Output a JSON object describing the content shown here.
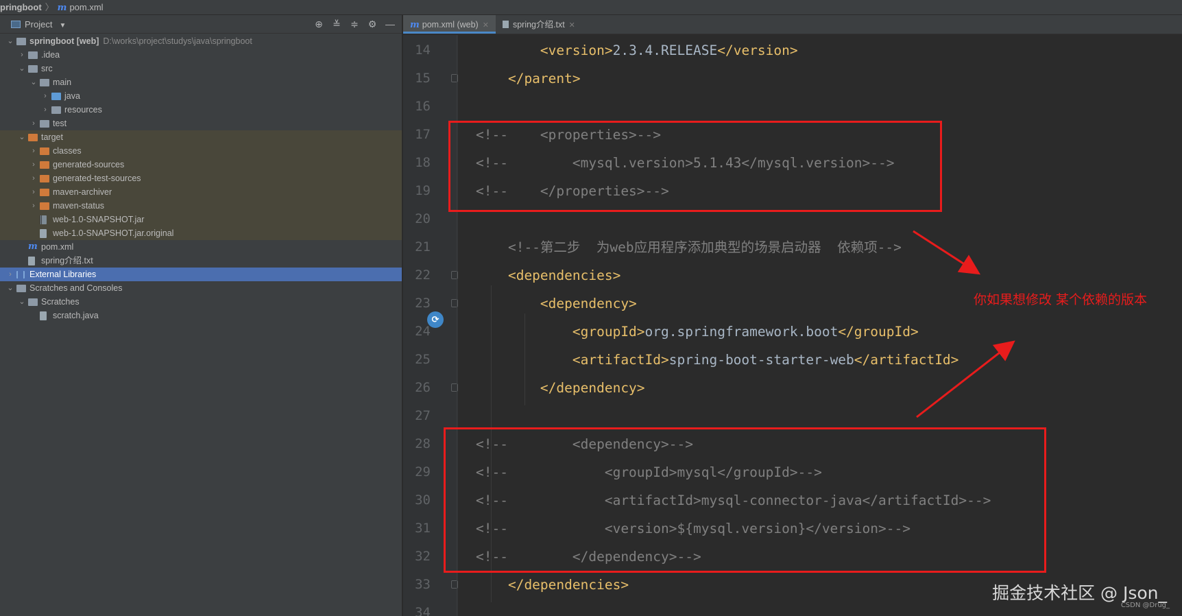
{
  "breadcrumb": {
    "project": "pringboot",
    "file": "pom.xml"
  },
  "project_panel": {
    "title": "Project",
    "tool_icons": [
      "locate-icon",
      "expand-all-icon",
      "collapse-all-icon",
      "gear-icon",
      "minimize-icon"
    ]
  },
  "tree": [
    {
      "indent": 0,
      "arrow": "v",
      "icon": "module-folder",
      "label": "springboot",
      "suffix": "[web]",
      "path": "D:\\works\\project\\studys\\java\\springboot"
    },
    {
      "indent": 1,
      "arrow": ">",
      "icon": "folder",
      "label": ".idea"
    },
    {
      "indent": 1,
      "arrow": "v",
      "icon": "folder",
      "label": "src"
    },
    {
      "indent": 2,
      "arrow": "v",
      "icon": "folder",
      "label": "main"
    },
    {
      "indent": 3,
      "arrow": ">",
      "icon": "source-folder",
      "label": "java"
    },
    {
      "indent": 3,
      "arrow": ">",
      "icon": "resources-folder",
      "label": "resources"
    },
    {
      "indent": 2,
      "arrow": ">",
      "icon": "folder",
      "label": "test"
    },
    {
      "indent": 1,
      "arrow": "v",
      "icon": "excluded-folder",
      "label": "target",
      "excluded": true
    },
    {
      "indent": 2,
      "arrow": ">",
      "icon": "excluded-folder",
      "label": "classes",
      "excluded": true
    },
    {
      "indent": 2,
      "arrow": ">",
      "icon": "excluded-folder",
      "label": "generated-sources",
      "excluded": true
    },
    {
      "indent": 2,
      "arrow": ">",
      "icon": "excluded-folder",
      "label": "generated-test-sources",
      "excluded": true
    },
    {
      "indent": 2,
      "arrow": ">",
      "icon": "excluded-folder",
      "label": "maven-archiver",
      "excluded": true
    },
    {
      "indent": 2,
      "arrow": ">",
      "icon": "excluded-folder",
      "label": "maven-status",
      "excluded": true
    },
    {
      "indent": 2,
      "arrow": "",
      "icon": "jar-file",
      "label": "web-1.0-SNAPSHOT.jar",
      "excluded": true
    },
    {
      "indent": 2,
      "arrow": "",
      "icon": "file",
      "label": "web-1.0-SNAPSHOT.jar.original",
      "excluded": true
    },
    {
      "indent": 1,
      "arrow": "",
      "icon": "maven-file",
      "label": "pom.xml"
    },
    {
      "indent": 1,
      "arrow": "",
      "icon": "text-file",
      "label": "spring介绍.txt"
    },
    {
      "indent": 0,
      "arrow": ">",
      "icon": "libraries",
      "label": "External Libraries",
      "selected": true
    },
    {
      "indent": 0,
      "arrow": "v",
      "icon": "scratches",
      "label": "Scratches and Consoles"
    },
    {
      "indent": 1,
      "arrow": "v",
      "icon": "folder",
      "label": "Scratches"
    },
    {
      "indent": 2,
      "arrow": "",
      "icon": "java-file",
      "label": "scratch.java"
    }
  ],
  "tabs": [
    {
      "label": "pom.xml (web)",
      "icon": "maven-file",
      "active": true
    },
    {
      "label": "spring介绍.txt",
      "icon": "text-file",
      "active": false
    }
  ],
  "editor": {
    "lines": [
      {
        "num": "14",
        "tokens": [
          [
            "tag",
            "        <version>"
          ],
          [
            "txt",
            "2.3.4.RELEASE"
          ],
          [
            "tag",
            "</version>"
          ]
        ]
      },
      {
        "num": "15",
        "tokens": [
          [
            "tag",
            "    </parent>"
          ]
        ],
        "fold": true
      },
      {
        "num": "16",
        "tokens": []
      },
      {
        "num": "17",
        "tokens": [
          [
            "cmt",
            "<!--    <properties>-->"
          ]
        ]
      },
      {
        "num": "18",
        "tokens": [
          [
            "cmt",
            "<!--        <mysql.version>5.1.43</mysql.version>-->"
          ]
        ]
      },
      {
        "num": "19",
        "tokens": [
          [
            "cmt",
            "<!--    </properties>-->"
          ]
        ]
      },
      {
        "num": "20",
        "tokens": []
      },
      {
        "num": "21",
        "tokens": [
          [
            "cmt",
            "    <!--第二步  为web应用程序添加典型的场景启动器  依赖项-->"
          ]
        ]
      },
      {
        "num": "22",
        "tokens": [
          [
            "tag",
            "    <dependencies>"
          ]
        ],
        "fold": true
      },
      {
        "num": "23",
        "tokens": [
          [
            "tag",
            "        <dependency>"
          ]
        ],
        "fold": true,
        "marker": true
      },
      {
        "num": "24",
        "tokens": [
          [
            "tag",
            "            <groupId>"
          ],
          [
            "txt",
            "org.springframework.boot"
          ],
          [
            "tag",
            "</groupId>"
          ]
        ]
      },
      {
        "num": "25",
        "tokens": [
          [
            "tag",
            "            <artifactId>"
          ],
          [
            "txt",
            "spring-boot-starter-web"
          ],
          [
            "tag",
            "</artifactId>"
          ]
        ]
      },
      {
        "num": "26",
        "tokens": [
          [
            "tag",
            "        </dependency>"
          ]
        ],
        "fold": true
      },
      {
        "num": "27",
        "tokens": []
      },
      {
        "num": "28",
        "tokens": [
          [
            "cmt",
            "<!--        <dependency>-->"
          ]
        ]
      },
      {
        "num": "29",
        "tokens": [
          [
            "cmt",
            "<!--            <groupId>mysql</groupId>-->"
          ]
        ]
      },
      {
        "num": "30",
        "tokens": [
          [
            "cmt",
            "<!--            <artifactId>mysql-connector-java</artifactId>-->"
          ]
        ]
      },
      {
        "num": "31",
        "tokens": [
          [
            "cmt",
            "<!--            <version>${mysql.version}</version>-->"
          ]
        ]
      },
      {
        "num": "32",
        "tokens": [
          [
            "cmt",
            "<!--        </dependency>-->"
          ]
        ]
      },
      {
        "num": "33",
        "tokens": [
          [
            "tag",
            "    </dependencies>"
          ]
        ],
        "fold": true
      },
      {
        "num": "34",
        "tokens": []
      }
    ]
  },
  "annotation": {
    "note": "你如果想修改 某个依赖的版本",
    "color": "#e81c1c"
  },
  "watermark": {
    "main": "掘金技术社区 @ Json_",
    "sub": "CSDN @Drug_"
  }
}
